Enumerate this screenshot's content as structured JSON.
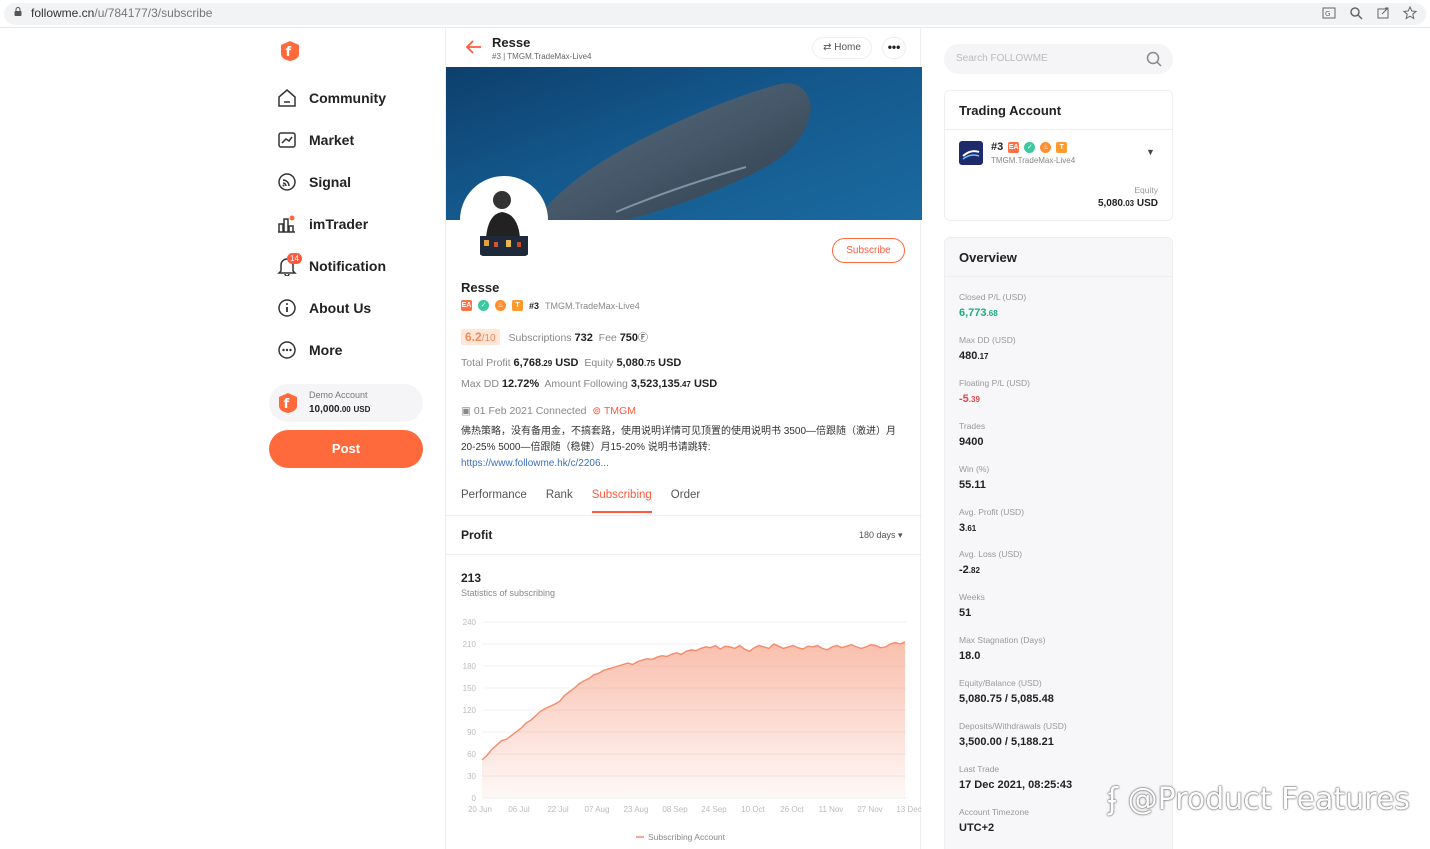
{
  "browser": {
    "url_host": "followme.cn",
    "url_path": "/u/784177/3/subscribe"
  },
  "sidebar": {
    "items": [
      {
        "label": "Community",
        "icon": "home-icon"
      },
      {
        "label": "Market",
        "icon": "chart-icon"
      },
      {
        "label": "Signal",
        "icon": "signal-icon"
      },
      {
        "label": "imTrader",
        "icon": "imtrader-icon"
      },
      {
        "label": "Notification",
        "icon": "bell-icon",
        "badge": "14"
      },
      {
        "label": "About Us",
        "icon": "info-icon"
      },
      {
        "label": "More",
        "icon": "more-icon"
      }
    ],
    "demo": {
      "label": "Demo Account",
      "amount": "10,000",
      "amount_dec": ".00",
      "currency": "USD"
    },
    "post_label": "Post"
  },
  "header": {
    "name": "Resse",
    "account": "#3",
    "server": "TMGM.TradeMax-Live4",
    "home_label": "Home",
    "more_label": "•••"
  },
  "profile": {
    "subscribe_label": "Subscribe",
    "name": "Resse",
    "account": "#3",
    "server": "TMGM.TradeMax-Live4",
    "score": "6.2",
    "score_max": "/10",
    "subscriptions_label": "Subscriptions",
    "subscriptions": "732",
    "fee_label": "Fee",
    "fee": "750",
    "total_profit_label": "Total Profit",
    "total_profit": "6,768",
    "total_profit_dec": ".29",
    "equity_label": "Equity",
    "equity": "5,080",
    "equity_dec": ".75",
    "currency": "USD",
    "maxdd_label": "Max DD",
    "maxdd": "12.72%",
    "amount_following_label": "Amount Following",
    "amount_following": "3,523,135",
    "amount_following_dec": ".47",
    "connected": "01 Feb 2021 Connected",
    "broker": "TMGM",
    "description": "佛热策略，没有备用金，不搞套路，使用说明详情可见顶置的使用说明书 3500—倍跟随（激进）月20-25% 5000—倍跟随（稳健）月15-20% 说明书请跳转:",
    "link": "https://www.followme.hk/c/2206..."
  },
  "tabs": [
    {
      "label": "Performance",
      "active": false
    },
    {
      "label": "Rank",
      "active": false
    },
    {
      "label": "Subscribing",
      "active": true
    },
    {
      "label": "Order",
      "active": false
    }
  ],
  "profit": {
    "title": "Profit",
    "range": "180 days",
    "stat_value": "213",
    "stat_label": "Statistics of subscribing"
  },
  "chart_data": {
    "type": "area",
    "title": "",
    "xlabel": "",
    "ylabel": "",
    "ylim": [
      0,
      240
    ],
    "yticks": [
      0,
      30,
      60,
      90,
      120,
      150,
      180,
      210,
      240
    ],
    "xticks": [
      "20 Jun",
      "06 Jul",
      "22 Jul",
      "07 Aug",
      "23 Aug",
      "08 Sep",
      "24 Sep",
      "10 Oct",
      "26 Oct",
      "11 Nov",
      "27 Nov",
      "13 Dec"
    ],
    "grid": true,
    "legend": "bottom",
    "color": "#f58a6a",
    "series": [
      {
        "name": "Subscribing Account",
        "values": [
          52,
          58,
          66,
          72,
          78,
          80,
          85,
          90,
          95,
          102,
          106,
          112,
          118,
          122,
          125,
          128,
          132,
          140,
          145,
          150,
          156,
          160,
          163,
          168,
          170,
          174,
          176,
          178,
          180,
          182,
          184,
          182,
          186,
          188,
          190,
          189,
          192,
          194,
          193,
          196,
          198,
          196,
          200,
          202,
          201,
          204,
          206,
          205,
          208,
          203,
          207,
          206,
          204,
          208,
          203,
          200,
          205,
          208,
          206,
          204,
          210,
          207,
          204,
          206,
          208,
          205,
          203,
          207,
          206,
          208,
          204,
          202,
          206,
          208,
          205,
          207,
          209,
          206,
          204,
          206,
          209,
          208,
          205,
          206,
          210,
          212,
          210,
          213
        ]
      }
    ]
  },
  "search": {
    "placeholder": "Search FOLLOWME"
  },
  "trading_account": {
    "title": "Trading Account",
    "account": "#3",
    "server": "TMGM.TradeMax-Live4",
    "equity_label": "Equity",
    "equity": "5,080",
    "equity_dec": ".03",
    "currency": "USD"
  },
  "overview": {
    "title": "Overview",
    "items": [
      {
        "label": "Closed P/L (USD)",
        "value": "6,773",
        "dec": ".68",
        "color": "#1aae7d"
      },
      {
        "label": "Max DD (USD)",
        "value": "480",
        "dec": ".17",
        "color": "#222"
      },
      {
        "label": "Floating P/L (USD)",
        "value": "-5",
        "dec": ".39",
        "color": "#e5484d"
      },
      {
        "label": "Trades",
        "value": "9400",
        "dec": "",
        "color": "#222"
      },
      {
        "label": "Win (%)",
        "value": "55.11",
        "dec": "",
        "color": "#222"
      },
      {
        "label": "Avg. Profit (USD)",
        "value": "3",
        "dec": ".61",
        "color": "#222"
      },
      {
        "label": "Avg. Loss (USD)",
        "value": "-2",
        "dec": ".82",
        "color": "#222"
      },
      {
        "label": "Weeks",
        "value": "51",
        "dec": "",
        "color": "#222"
      },
      {
        "label": "Max Stagnation (Days)",
        "value": "18.0",
        "dec": "",
        "color": "#222"
      },
      {
        "label": "Equity/Balance (USD)",
        "value": "5,080.75 / 5,085.48",
        "dec": "",
        "color": "#222"
      },
      {
        "label": "Deposits/Withdrawals (USD)",
        "value": "3,500.00 / 5,188.21",
        "dec": "",
        "color": "#222"
      },
      {
        "label": "Last Trade",
        "value": "17 Dec 2021, 08:25:43",
        "dec": "",
        "color": "#222"
      },
      {
        "label": "Account Timezone",
        "value": "UTC+2",
        "dec": "",
        "color": "#222"
      }
    ]
  },
  "watermark": "@Product Features"
}
